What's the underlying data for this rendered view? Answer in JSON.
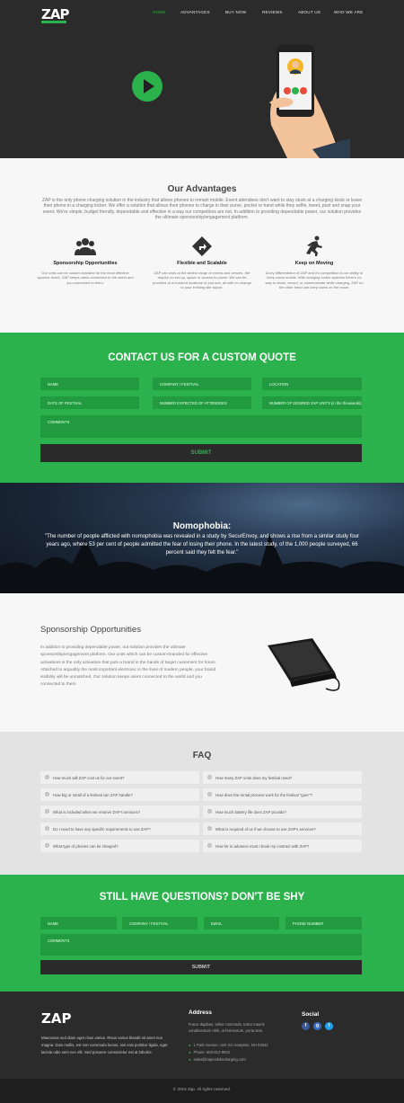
{
  "brand": {
    "logo_text": "ZAP",
    "accent": "#2bb24c",
    "dark": "#2b2b2b"
  },
  "nav": {
    "items": [
      "HOME",
      "ADVANTAGES",
      "BUY NOW",
      "REVIEWS",
      "ABOUT US",
      "WHO WE ARE"
    ],
    "active": "HOME"
  },
  "hero": {
    "play_icon": "play-icon"
  },
  "advantages": {
    "title": "Our Advantages",
    "intro": "ZAP is the only phone charging solution in the industry that allows phones to remain mobile.  Event attendees don't want to stay stuck at a charging kiosk or leave their phone in a charging locker.  We offer a solution that allows their phones to charge in their purse, pocket or hand while they selfie, tweet, post and snap your event.  We're simple, budget friendly, dependable and effective in a way our competitors are not. In addition to providing dependable power, our solution provides the ultimate sponsorship/engagement platform.",
    "features": [
      {
        "icon": "people-icon",
        "title": "Sponsorship Opportunities",
        "text": "Our units can be custom branded for the most effective sponsor reach. ZAP keeps users connected to the world and you connected to them."
      },
      {
        "icon": "directions-icon",
        "title": "Flexible and Scalable",
        "text": "ZAP can work at the widest range of events and venues. We require no set-up, space or access to power. We can be provided at a hundred locations or just one, all with no change to your existing site layout."
      },
      {
        "icon": "runner-icon",
        "title": "Keep on Moving",
        "text": "A key differentiator of ZAP and it's competition is our ability to keep users mobile. With charging locker systems there's no way to share, record, or communicate while charging. ZAP on the other hand can keep users on the move."
      }
    ]
  },
  "quote_form": {
    "title": "CONTACT US FOR A CUSTOM QUOTE",
    "row1": [
      "NAME",
      "COMPANY / FESTIVAL",
      "LOCATION"
    ],
    "row2": [
      "DATE OF FESTIVAL",
      "NUMBER EXPECTED OF ATTENDEES",
      "NUMBER OF DESIRED ZAP UNITS (in the thousands)"
    ],
    "comments": "COMMENTS",
    "submit": "SUBMIT"
  },
  "nomophobia": {
    "title": "Nomophobia:",
    "text": "\"The number of people afflicted with nomophobia was revealed in a study by SecurEnvoy, and shows a rise from a similar study four years ago, where 53 per cent of people admitted the fear of losing their phone. In the latest study, of the 1,000 people surveyed, 66 percent said they felt the fear.\""
  },
  "sponsorship": {
    "title": "Sponsorship Opportunities",
    "text": "In addition to providing dependable power, out solution provides the ultimate sponsorship/engagement platform.  Our units which can be custom-branded for effective activations is the only activation that puts a brand in the hands of target customers for hours.  Attached to arguably the most important electronic in the lives of modern people, your brand visibility will be unmatched.  Our solution keeps users connected to the world and you connected to them."
  },
  "faq": {
    "title": "FAQ",
    "left": [
      "How much will ZAP cost us for our event?",
      "How big or small of a festival can ZAP handle?",
      "What is included when we reserve ZAP's services?",
      "Do I need to have any specific requirements to use ZAP?",
      "What type of phones can be charged?"
    ],
    "right": [
      "How many ZAP units does my festival need?",
      "How does the rental process work for the festival \"goer\"?",
      "How much battery life does ZAP provide?",
      "What is required of us if we choose to use ZAP's services?",
      "How far in advance must I book my contract with ZAP?"
    ]
  },
  "questions_form": {
    "title": "STILL HAVE QUESTIONS? DON'T BE SHY",
    "fields": [
      "NAME",
      "COMPANY / FESTIVAL",
      "EMAIL",
      "PHONE NUMBER"
    ],
    "comments": "COMMENTS",
    "submit": "SUBMIT"
  },
  "footer": {
    "logo_text": "ZAP",
    "about": "Maecenas sed diam eget risus varius. Risus varius blandit sit amet non magna. Duis mollis, est non commodo luctus, nisi erat porttitor ligula, eget lacinia odio sem nec elit. Sed posuere consectetur est at lobortis.",
    "address_title": "Address",
    "address_text": "Fusce dapibus, tellus commodo, tortor mauris condimentum nibh, ut fermentum, porta sem.",
    "street": "1 Park Avenue, Unit G1 Hampton, NH 03842",
    "phone": "Phone: 603-812-9502",
    "email": "sales@zapmobilecharging.com",
    "social_title": "Social",
    "social": [
      {
        "icon": "facebook-icon",
        "glyph": "f",
        "color": "#3b5998"
      },
      {
        "icon": "googleplus-icon",
        "glyph": "g",
        "color": "#3a6fc4"
      },
      {
        "icon": "twitter-icon",
        "glyph": "t",
        "color": "#1da1f2"
      }
    ],
    "copyright": "© 2016 Zap. All rights reserved."
  }
}
